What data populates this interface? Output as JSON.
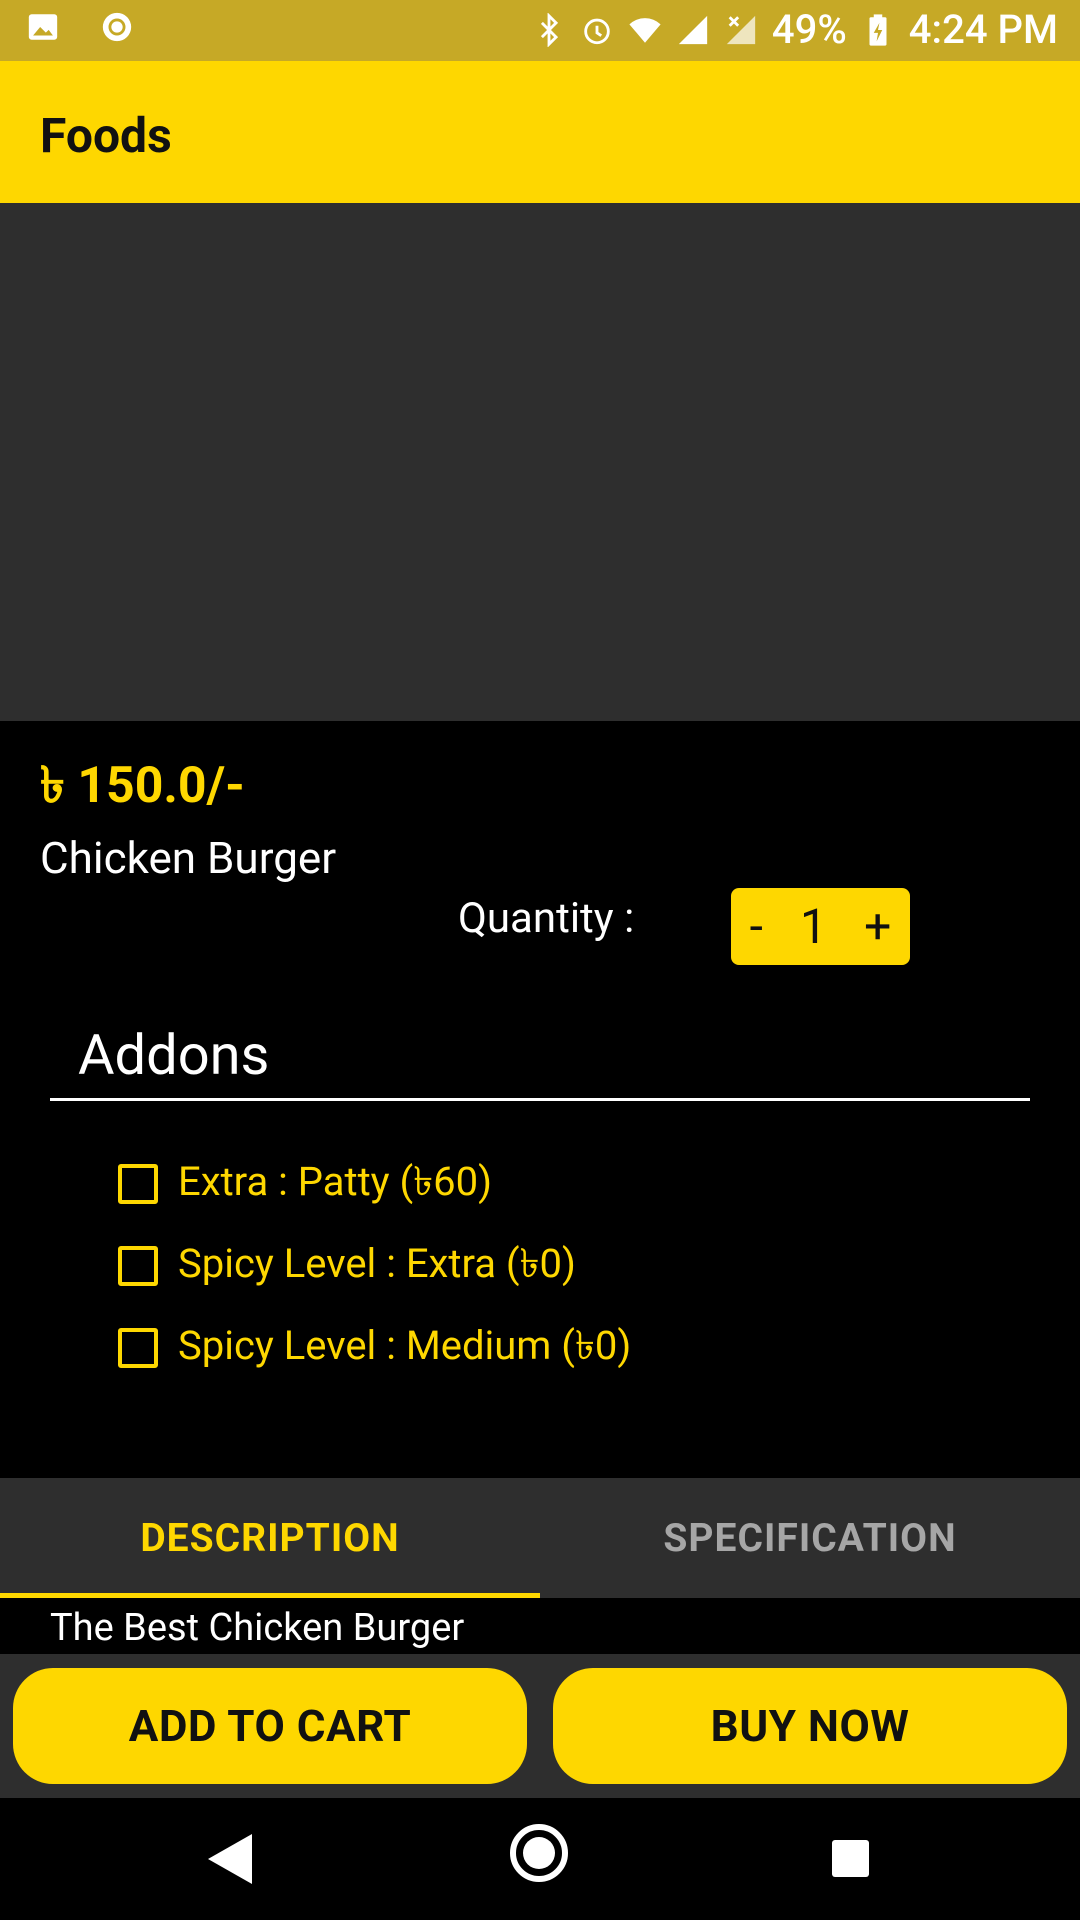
{
  "status_bar": {
    "battery_percent": "49%",
    "time": "4:24 PM"
  },
  "app_bar": {
    "title": "Foods"
  },
  "product": {
    "price": "৳ 150.0/-",
    "name": "Chicken Burger",
    "quantity_label": "Quantity :",
    "quantity_value": "1",
    "decrement_label": "-",
    "increment_label": "+"
  },
  "addons": {
    "title": "Addons",
    "items": [
      {
        "label": "Extra : Patty  (৳60)"
      },
      {
        "label": "Spicy Level : Extra (৳0)"
      },
      {
        "label": "Spicy Level : Medium (৳0)"
      }
    ]
  },
  "tabs": [
    {
      "label": "DESCRIPTION",
      "active": true
    },
    {
      "label": "SPECIFICATION",
      "active": false
    }
  ],
  "description": {
    "text": "The Best Chicken Burger"
  },
  "actions": {
    "add_to_cart": "ADD TO CART",
    "buy_now": "BUY NOW"
  },
  "colors": {
    "accent": "#fed700",
    "status_bar": "#c6a926",
    "surface": "#2e2e2e",
    "background": "#000000"
  }
}
